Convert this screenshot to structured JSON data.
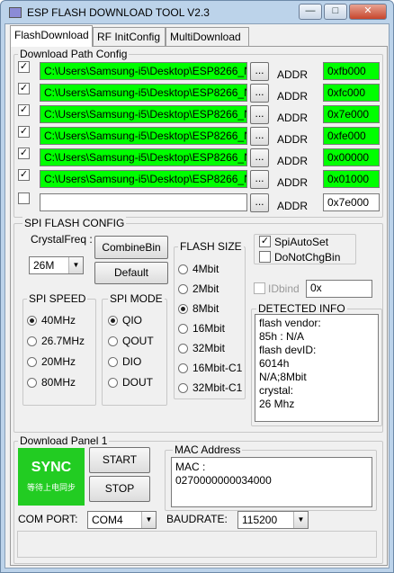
{
  "window": {
    "title": "ESP FLASH DOWNLOAD TOOL V2.3",
    "minimize": "—",
    "maximize": "□",
    "close": "✕"
  },
  "tabs": [
    "FlashDownload",
    "RF InitConfig",
    "MultiDownload"
  ],
  "download_path": {
    "label": "Download Path Config",
    "rows": [
      {
        "checked": "✓",
        "path": "C:\\Users\\Samsung-i5\\Desktop\\ESP8266_N",
        "browse": "...",
        "addr_label": "ADDR",
        "addr": "0xfb000"
      },
      {
        "checked": "✓",
        "path": "C:\\Users\\Samsung-i5\\Desktop\\ESP8266_N",
        "browse": "...",
        "addr_label": "ADDR",
        "addr": "0xfc000"
      },
      {
        "checked": "✓",
        "path": "C:\\Users\\Samsung-i5\\Desktop\\ESP8266_N",
        "browse": "...",
        "addr_label": "ADDR",
        "addr": "0x7e000"
      },
      {
        "checked": "✓",
        "path": "C:\\Users\\Samsung-i5\\Desktop\\ESP8266_N",
        "browse": "...",
        "addr_label": "ADDR",
        "addr": "0xfe000"
      },
      {
        "checked": "✓",
        "path": "C:\\Users\\Samsung-i5\\Desktop\\ESP8266_N",
        "browse": "...",
        "addr_label": "ADDR",
        "addr": "0x00000"
      },
      {
        "checked": "✓",
        "path": "C:\\Users\\Samsung-i5\\Desktop\\ESP8266_N",
        "browse": "...",
        "addr_label": "ADDR",
        "addr": "0x01000"
      },
      {
        "checked": "",
        "path": "",
        "browse": "...",
        "addr_label": "ADDR",
        "addr": "0x7e000"
      }
    ]
  },
  "spi": {
    "label": "SPI FLASH CONFIG",
    "crystal_label": "CrystalFreq :",
    "crystal_value": "26M",
    "combine_bin": "CombineBin",
    "default": "Default",
    "speed": {
      "label": "SPI SPEED",
      "options": [
        "40MHz",
        "26.7MHz",
        "20MHz",
        "80MHz"
      ],
      "selected": "40MHz"
    },
    "mode": {
      "label": "SPI MODE",
      "options": [
        "QIO",
        "QOUT",
        "DIO",
        "DOUT"
      ],
      "selected": "QIO"
    },
    "size": {
      "label": "FLASH SIZE",
      "options": [
        "4Mbit",
        "2Mbit",
        "8Mbit",
        "16Mbit",
        "32Mbit",
        "16Mbit-C1",
        "32Mbit-C1"
      ],
      "selected": "8Mbit"
    },
    "spi_auto_set": {
      "label": "SpiAutoSet",
      "checked": "✓"
    },
    "do_not_chg_bin": {
      "label": "DoNotChgBin",
      "checked": ""
    },
    "idbind": {
      "label": "IDbind",
      "checked": "",
      "value": "0x"
    },
    "detected": {
      "label": "DETECTED INFO",
      "lines": [
        "flash vendor:",
        "85h : N/A",
        "flash devID:",
        "6014h",
        "N/A;8Mbit",
        "crystal:",
        "26 Mhz"
      ]
    }
  },
  "download_panel": {
    "label": "Download Panel 1",
    "status": "SYNC",
    "status_sub": "等待上电同步",
    "status_color": "#22cc22",
    "start": "START",
    "stop": "STOP",
    "mac_label": "MAC Address",
    "mac_lines": [
      "MAC :",
      "0270000000034000"
    ]
  },
  "com": {
    "label": "COM PORT:",
    "value": "COM4"
  },
  "baud": {
    "label": "BAUDRATE:",
    "value": "115200"
  }
}
